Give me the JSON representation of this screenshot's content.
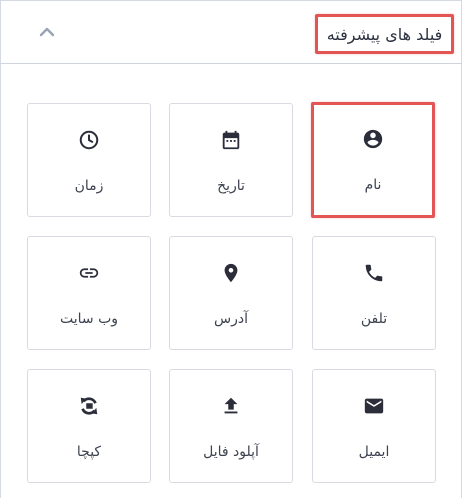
{
  "panel": {
    "title": "فیلد های پیشرفته",
    "collapse_icon": "chevron-up-icon"
  },
  "fields": [
    {
      "key": "name",
      "label": "نام",
      "icon": "account-circle-icon"
    },
    {
      "key": "date",
      "label": "تاریخ",
      "icon": "calendar-icon"
    },
    {
      "key": "time",
      "label": "زمان",
      "icon": "clock-icon"
    },
    {
      "key": "phone",
      "label": "تلفن",
      "icon": "phone-icon"
    },
    {
      "key": "address",
      "label": "آدرس",
      "icon": "map-pin-icon"
    },
    {
      "key": "website",
      "label": "وب سایت",
      "icon": "link-icon"
    },
    {
      "key": "email",
      "label": "ایمیل",
      "icon": "mail-icon"
    },
    {
      "key": "file_upload",
      "label": "آپلود فایل",
      "icon": "upload-icon"
    },
    {
      "key": "captcha",
      "label": "کپچا",
      "icon": "recaptcha-icon"
    }
  ],
  "colors": {
    "highlight": "#e35454",
    "icon": "#2b2e3a",
    "border": "#d8dbe2"
  }
}
